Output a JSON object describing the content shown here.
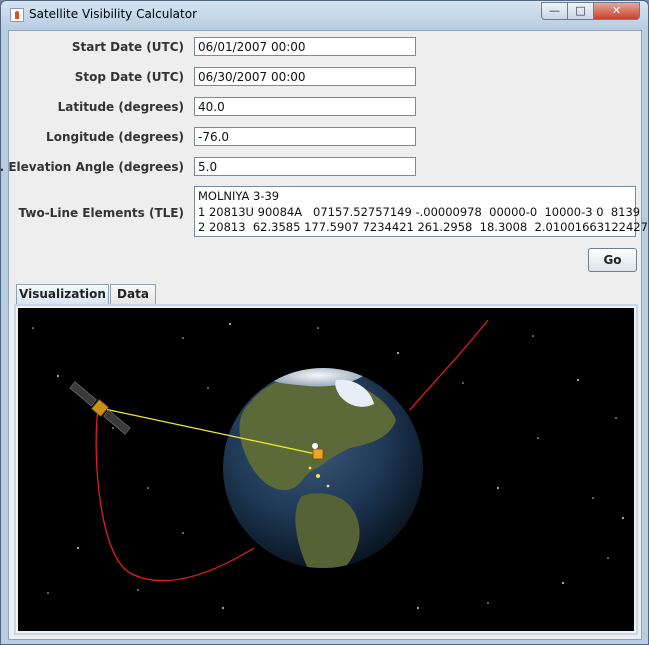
{
  "window": {
    "title": "Satellite Visibility Calculator"
  },
  "form": {
    "start_date": {
      "label": "Start Date (UTC)",
      "value": "06/01/2007 00:00"
    },
    "stop_date": {
      "label": "Stop Date (UTC)",
      "value": "06/30/2007 00:00"
    },
    "latitude": {
      "label": "Latitude (degrees)",
      "value": "40.0"
    },
    "longitude": {
      "label": "Longitude (degrees)",
      "value": "-76.0"
    },
    "min_elevation": {
      "label": "Min. Elevation Angle (degrees)",
      "value": "5.0"
    },
    "tle": {
      "label": "Two-Line Elements (TLE)",
      "lines": [
        "MOLNIYA 3-39",
        "1 20813U 90084A   07157.52757149 -.00000978  00000-0  10000-3 0  8139",
        "2 20813  62.3585 177.5907 7234421 261.2958  18.3008  2.01001663122427"
      ]
    },
    "go_label": "Go"
  },
  "tabs": {
    "visualization": "Visualization",
    "data": "Data",
    "selected": "Visualization"
  },
  "scene": {
    "icons": [
      "satellite-icon",
      "ground-station-icon",
      "earth-globe"
    ],
    "colors": {
      "background": "#000000",
      "orbit": "#e0201a",
      "line_of_sight": "#f4f020",
      "ocean": "#1d3757",
      "land": "#5c6a3a"
    }
  }
}
